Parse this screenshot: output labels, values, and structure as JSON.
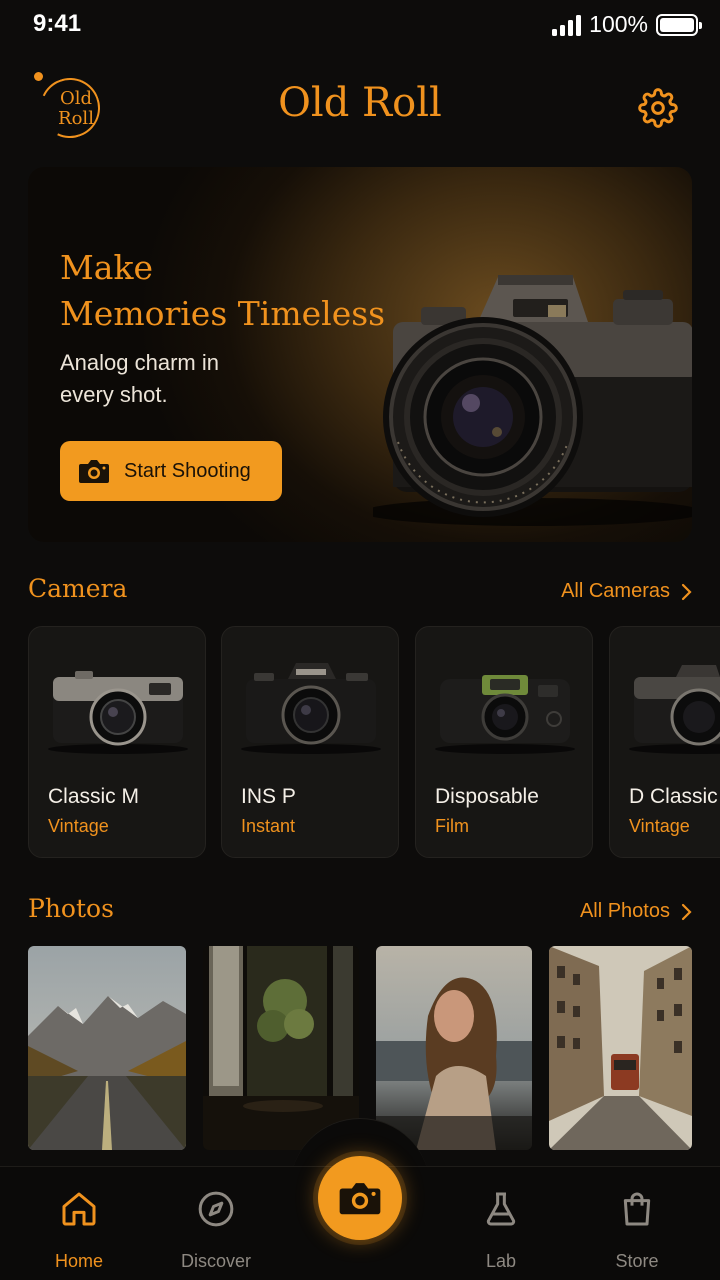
{
  "status_bar": {
    "time": "9:41",
    "battery": "100%"
  },
  "header": {
    "logo_text": "Old Roll",
    "title": "Old Roll"
  },
  "hero": {
    "title_line1": "Make",
    "title_line2": "Memories Timeless",
    "subtitle_line1": "Analog charm in",
    "subtitle_line2": "every shot.",
    "button_label": "Start Shooting"
  },
  "camera_section": {
    "title": "Camera",
    "link_label": "All Cameras",
    "items": [
      {
        "name": "Classic M",
        "type": "Vintage"
      },
      {
        "name": "INS P",
        "type": "Instant"
      },
      {
        "name": "Disposable",
        "type": "Film"
      },
      {
        "name": "D Classic",
        "type": "Vintage"
      }
    ]
  },
  "photos_section": {
    "title": "Photos",
    "link_label": "All Photos"
  },
  "nav": {
    "items": [
      {
        "label": "Home",
        "icon": "home-icon",
        "active": true
      },
      {
        "label": "Discover",
        "icon": "compass-icon",
        "active": false
      },
      {
        "label": "Lab",
        "icon": "flask-icon",
        "active": false
      },
      {
        "label": "Store",
        "icon": "bag-icon",
        "active": false
      }
    ],
    "center_icon": "camera-icon"
  },
  "colors": {
    "accent": "#f0921e",
    "background": "#0d0c0b",
    "card": "#171614"
  }
}
